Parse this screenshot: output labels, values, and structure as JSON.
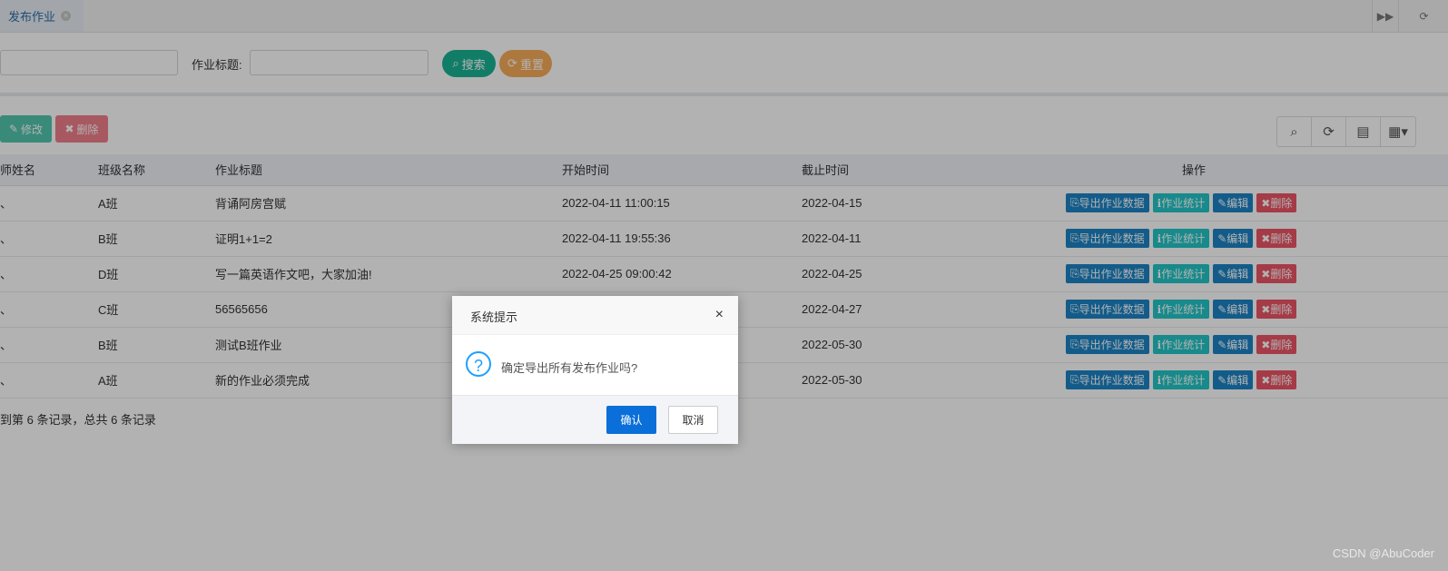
{
  "tabs": [
    {
      "label": "发布作业",
      "close": "×"
    }
  ],
  "search": {
    "title_label": "作业标题:",
    "search_button": "搜索",
    "reset_button": "重置"
  },
  "toolbar": {
    "edit_button": "修改",
    "delete_button": "删除"
  },
  "table": {
    "headers": [
      "师姓名",
      "班级名称",
      "作业标题",
      "开始时间",
      "截止时间",
      "操作"
    ],
    "rows": [
      {
        "teacher": "、",
        "class": "A班",
        "title": "背诵阿房宫赋",
        "start": "2022-04-11 11:00:15",
        "end": "2022-04-15"
      },
      {
        "teacher": "、",
        "class": "B班",
        "title": "证明1+1=2",
        "start": "2022-04-11 19:55:36",
        "end": "2022-04-11"
      },
      {
        "teacher": "、",
        "class": "D班",
        "title": "写一篇英语作文吧，大家加油!",
        "start": "2022-04-25 09:00:42",
        "end": "2022-04-25"
      },
      {
        "teacher": "、",
        "class": "C班",
        "title": "56565656",
        "start": "",
        "end": "2022-04-27"
      },
      {
        "teacher": "、",
        "class": "B班",
        "title": "测试B班作业",
        "start": "",
        "end": "2022-05-30"
      },
      {
        "teacher": "、",
        "class": "A班",
        "title": "新的作业必须完成",
        "start": "",
        "end": "2022-05-30"
      }
    ],
    "row_actions": {
      "export": "导出作业数据",
      "stats": "作业统计",
      "edit": "编辑",
      "delete": "删除"
    }
  },
  "pagination": {
    "summary": "到第 6 条记录，总共 6 条记录"
  },
  "dialog": {
    "title": "系统提示",
    "close": "×",
    "message": "确定导出所有发布作业吗?",
    "confirm": "确认",
    "cancel": "取消"
  },
  "watermark": "CSDN @AbuCoder"
}
